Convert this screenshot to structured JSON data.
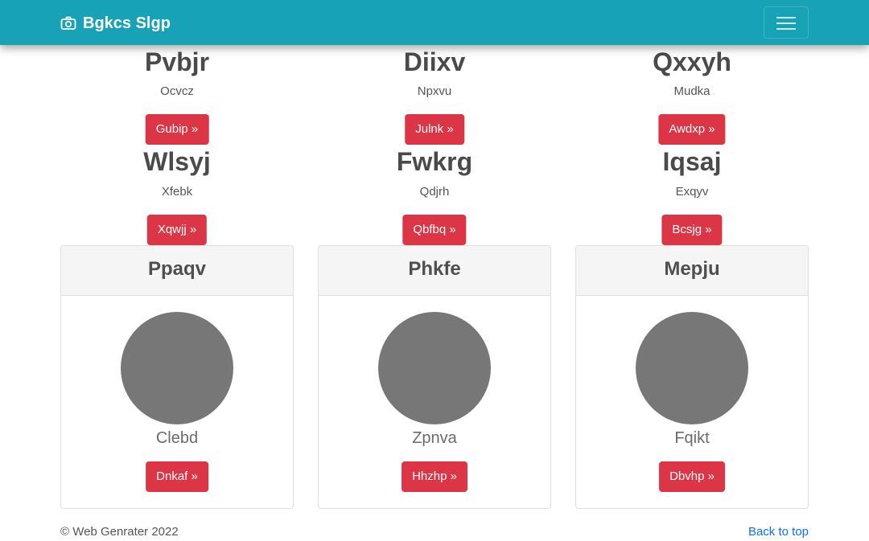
{
  "navbar": {
    "brand_icon": "camera-icon",
    "brand_text": "Bgkcs Slgp",
    "toggler_icon": "hamburger-menu-icon",
    "background": "#17a2b8"
  },
  "features_row1": [
    {
      "title": "Pvbjr",
      "text": "Ocvcz",
      "button": "Gubip »"
    },
    {
      "title": "Diixv",
      "text": "Npxvu",
      "button": "Julnk »"
    },
    {
      "title": "Qxxyh",
      "text": "Mudka",
      "button": "Awdxp »"
    }
  ],
  "features_row2": [
    {
      "title": "Wlsyj",
      "text": "Xfebk",
      "button": "Xqwjj »"
    },
    {
      "title": "Fwkrg",
      "text": "Qdjrh",
      "button": "Qbfbq »"
    },
    {
      "title": "Iqsaj",
      "text": "Exqyv",
      "button": "Bcsjg »"
    }
  ],
  "cards": [
    {
      "header": "Ppaqv",
      "name": "Clebd",
      "button": "Dnkaf »"
    },
    {
      "header": "Phkfe",
      "name": "Zpnva",
      "button": "Hhzhp »"
    },
    {
      "header": "Mepju",
      "name": "Fqikt",
      "button": "Dbvhp »"
    }
  ],
  "footer": {
    "copyright": "© Web Genrater 2022",
    "back_to_top": "Back to top"
  },
  "colors": {
    "accent": "#17a2b8",
    "button": "#dc3545",
    "link": "#0d6efd",
    "avatar": "#777777"
  }
}
